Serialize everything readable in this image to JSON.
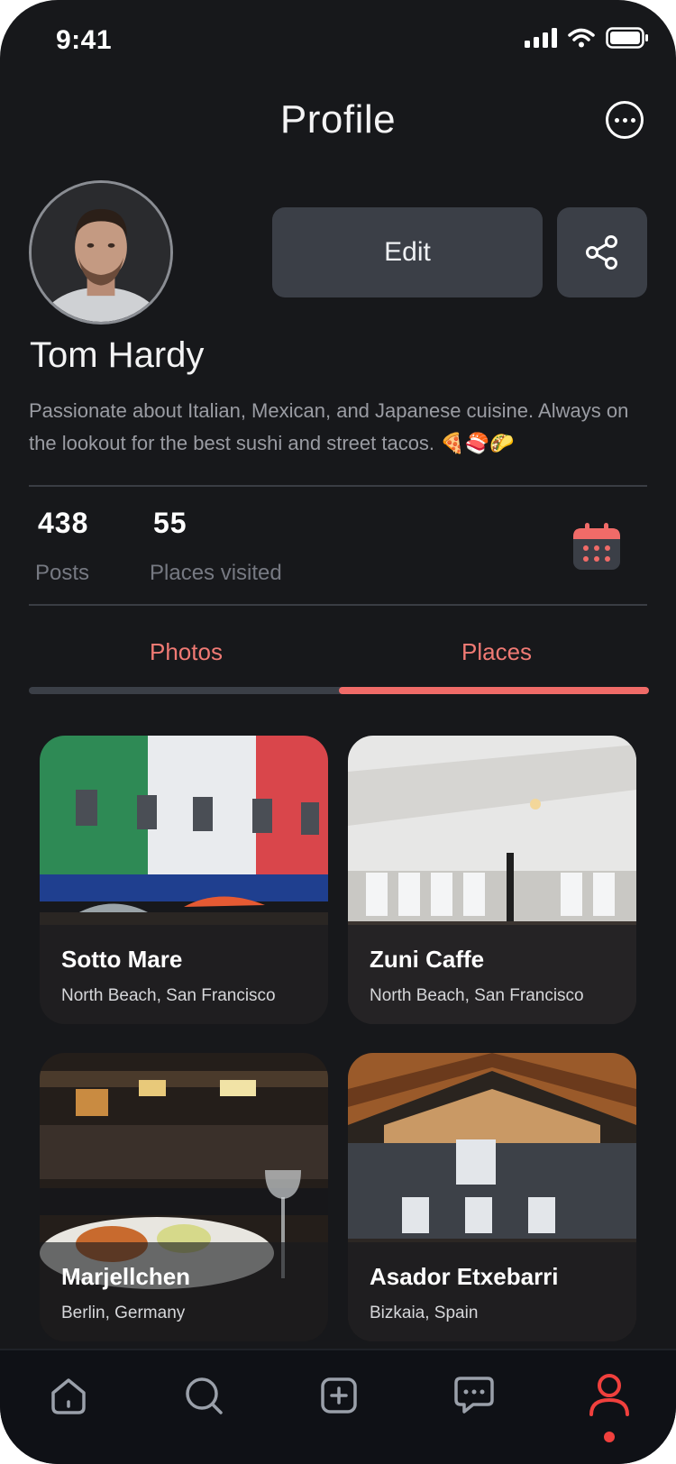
{
  "status_bar": {
    "time": "9:41"
  },
  "header": {
    "title": "Profile"
  },
  "profile": {
    "name": "Tom Hardy",
    "bio": "Passionate about Italian, Mexican, and Japanese cuisine. Always on the lookout for the best sushi and street tacos. 🍕🍣🌮",
    "edit_label": "Edit"
  },
  "stats": [
    {
      "value": "438",
      "label": "Posts"
    },
    {
      "value": "55",
      "label": "Places visited"
    }
  ],
  "tabs": [
    {
      "label": "Photos",
      "active": false
    },
    {
      "label": "Places",
      "active": true
    }
  ],
  "places": [
    {
      "name": "Sotto Mare",
      "location": "North Beach, San Francisco"
    },
    {
      "name": "Zuni Caffe",
      "location": "North Beach, San Francisco"
    },
    {
      "name": "Marjellchen",
      "location": "Berlin, Germany"
    },
    {
      "name": "Asador Etxebarri",
      "location": "Bizkaia, Spain"
    }
  ],
  "nav": {
    "items": [
      "home-icon",
      "search-icon",
      "add-icon",
      "chat-icon",
      "profile-icon"
    ],
    "active": "profile-icon"
  },
  "colors": {
    "background": "#17181b",
    "accent": "#f06b68",
    "button": "#3b3f47",
    "nav_active": "#f0403d"
  }
}
